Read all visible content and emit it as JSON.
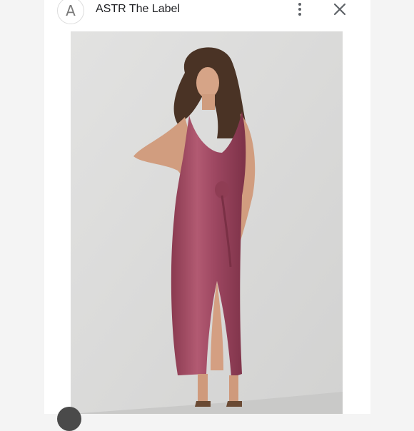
{
  "app": {
    "avatar_letter": "A",
    "title": "ASTR The Label"
  },
  "icons": {
    "more": "more-vert-icon",
    "close": "close-icon"
  },
  "colors": {
    "dress": "#a0485f",
    "backdrop": "#dcdcdb",
    "page": "#f4f4f4"
  }
}
